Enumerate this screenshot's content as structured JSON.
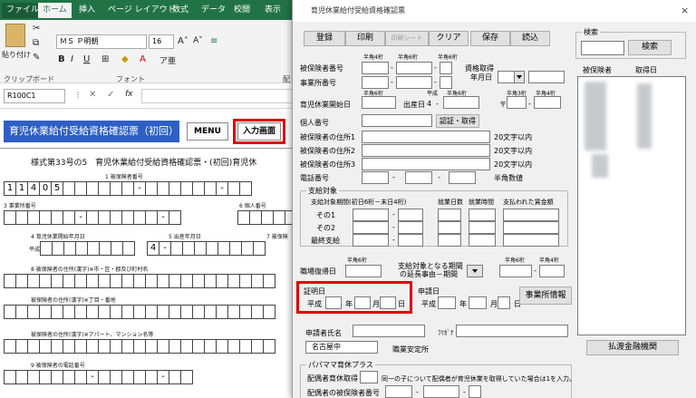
{
  "excel": {
    "tabs": [
      "ファイル",
      "ホーム",
      "挿入",
      "ページ レイアウト",
      "数式",
      "データ",
      "校閲",
      "表示"
    ],
    "active_tab": "ホーム",
    "clipboard_label": "貼り付け",
    "clipboard_group": "クリップボード",
    "font_group": "フォント",
    "font_name": "ＭＳ Ｐ明朝",
    "font_size": "16",
    "cell_ref": "R100C1",
    "fx": "fx",
    "group_cut": "配"
  },
  "sheet": {
    "title": "育児休業給付受給資格確認票（初回）",
    "menu_button": "MENU",
    "input_button": "入力画面",
    "form_heading": "様式第33号の5　育児休業給付受給資格確認票・(初回)育児休",
    "label_insured_no": "1 被保険者番号",
    "insured_digits": [
      "1",
      "1",
      "4",
      "0",
      "5"
    ],
    "dash": "-",
    "label_office_no": "3 事業所番号",
    "label_personal_no": "6 個人番号",
    "label_start_date": "4 育児休業開始年月日",
    "label_birth_date": "5 出産年月日",
    "label_insured_7": "7 被保険",
    "era_label": "平成",
    "era_num": "4",
    "label_addr_kanji": "8 被保険者の住所(漢字)※市・区・郡及び町村名",
    "label_addr_chome": "被保険者の住所(漢字)※丁目・番地",
    "label_addr_bldg": "被保険者の住所(漢字)※アパート、マンション名等",
    "label_phone": "9 被保険者の電話番号"
  },
  "dialog": {
    "title": "育児休業給付受給資格確認票",
    "close": "×",
    "buttons": {
      "register": "登録",
      "print": "印刷",
      "print_sheet": "印刷シート",
      "clear": "クリア",
      "save": "保存",
      "load": "読込"
    },
    "search": {
      "group": "検索",
      "button": "検索",
      "col_insured": "被保険者",
      "col_date": "取得日"
    },
    "hankaku4": "半角4桁",
    "hankaku6": "半角6桁",
    "hankaku2": "半角2桁",
    "hankaku3": "半角3桁",
    "insured_no": "被保険者番号",
    "office_no": "事業所番号",
    "acquired_date": "資格取得\n年月日",
    "acquired_line1": "資格取得",
    "acquired_line2": "年月日",
    "leave_start": "育児休業開始日",
    "birth_date": "出産日",
    "heisei": "平成",
    "era_4": "4",
    "postal": "〒",
    "personal_no": "個人番号",
    "verify_btn": "認証・取得",
    "addr1": "被保険者の住所1",
    "addr2": "被保険者の住所2",
    "addr3": "被保険者の住所3",
    "within20": "20文字以内",
    "phone": "電話番号",
    "phone_hint": "半角数値",
    "pay_target": "支給対象",
    "pay_period_hdr": "支給対象期間(初日6桁－末日4桁)",
    "work_days": "就業日数",
    "work_hours": "就業時間",
    "wage_paid": "支払われた賃金額",
    "row1": "その1",
    "row2": "その2",
    "final": "最終支給",
    "return_date": "職場復帰日",
    "ext_reason_1": "支給対象となる期間",
    "ext_reason_2": "の延長事由－期間",
    "cert_date": "証明日",
    "apply_date": "申請日",
    "year": "年",
    "month": "月",
    "day": "日",
    "office_info": "事業所情報",
    "applicant": "申請者氏名",
    "furigana": "ﾌﾘｶﾞﾅ",
    "office_city": "名古屋中",
    "employment_office": "職業安定所",
    "bank_btn": "払渡金融機関",
    "papamama": "パパママ育休プラス",
    "spouse_leave": "配偶者育休取得",
    "spouse_note": "同一の子について配偶者が育児休業を取得していた場合は1を入力。",
    "spouse_insured": "配偶者の被保険者番号"
  },
  "colors": {
    "excel_green": "#217346",
    "title_blue": "#2f5fc4",
    "highlight": "#e00000"
  }
}
